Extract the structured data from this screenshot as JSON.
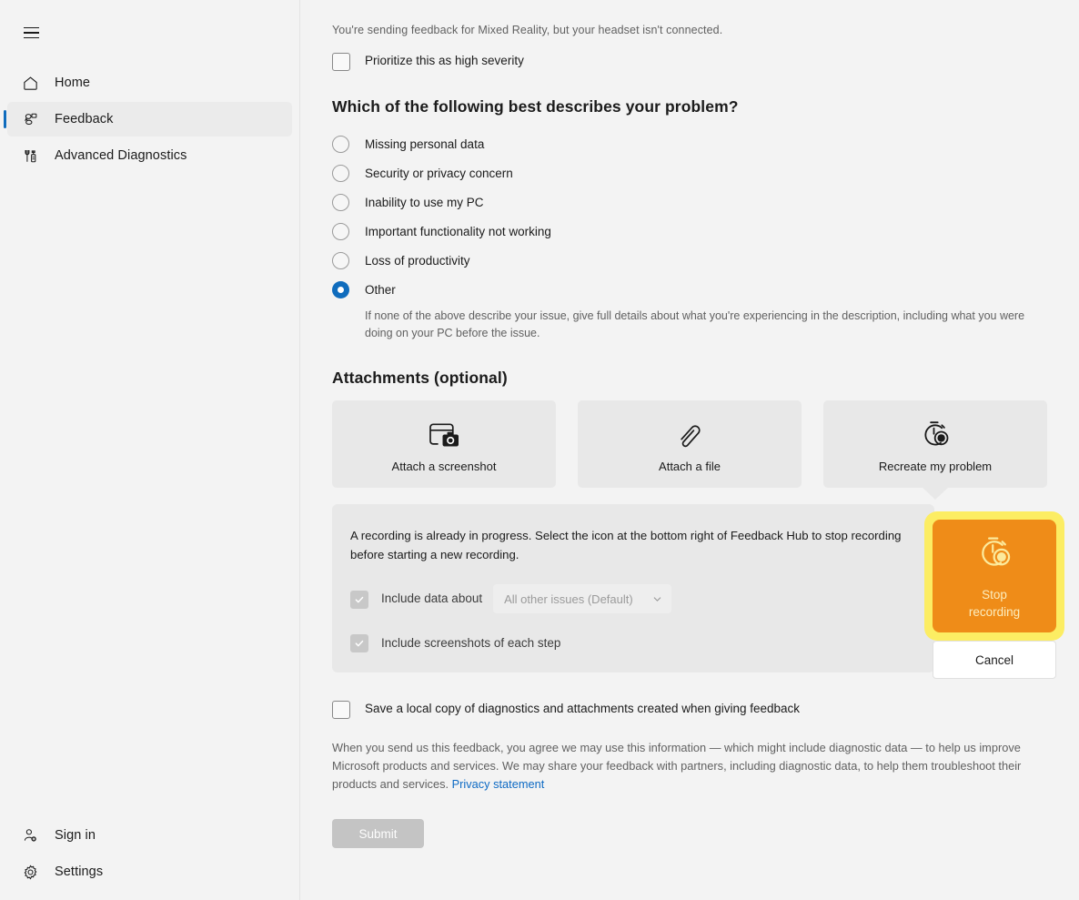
{
  "sidebar": {
    "menu_icon": "hamburger-icon",
    "items": [
      {
        "label": "Home",
        "icon": "home-icon",
        "active": false
      },
      {
        "label": "Feedback",
        "icon": "feedback-icon",
        "active": true
      },
      {
        "label": "Advanced Diagnostics",
        "icon": "diagnostics-icon",
        "active": false
      }
    ],
    "bottom_items": [
      {
        "label": "Sign in",
        "icon": "person-add-icon"
      },
      {
        "label": "Settings",
        "icon": "gear-icon"
      }
    ]
  },
  "main": {
    "headset_note": "You're sending feedback for Mixed Reality, but your headset isn't connected.",
    "priority_checkbox_label": "Prioritize this as high severity",
    "problem_heading": "Which of the following best describes your problem?",
    "problem_options": [
      {
        "label": "Missing personal data",
        "selected": false
      },
      {
        "label": "Security or privacy concern",
        "selected": false
      },
      {
        "label": "Inability to use my PC",
        "selected": false
      },
      {
        "label": "Important functionality not working",
        "selected": false
      },
      {
        "label": "Loss of productivity",
        "selected": false
      },
      {
        "label": "Other",
        "selected": true
      }
    ],
    "other_help_text": "If none of the above describe your issue, give full details about what you're experiencing in the description, including what you were doing on your PC before the issue.",
    "attachments_heading": "Attachments (optional)",
    "attachments": [
      {
        "label": "Attach a screenshot",
        "icon": "screenshot-icon"
      },
      {
        "label": "Attach a file",
        "icon": "paperclip-icon"
      },
      {
        "label": "Recreate my problem",
        "icon": "stopwatch-record-icon"
      }
    ],
    "recording_panel": {
      "message": "A recording is already in progress. Select the icon at the bottom right of Feedback Hub to stop recording before starting a new recording.",
      "include_data_label": "Include data about",
      "include_data_checked": true,
      "dropdown_value": "All other issues (Default)",
      "dropdown_icon": "chevron-down-icon",
      "include_screenshots_label": "Include screenshots of each step",
      "include_screenshots_checked": true
    },
    "stop_flyout": {
      "icon": "stopwatch-record-icon",
      "stop_label_line1": "Stop",
      "stop_label_line2": "recording",
      "cancel_label": "Cancel",
      "highlight_color": "#fced63",
      "button_color": "#ef8c18"
    },
    "save_local_copy_label": "Save a local copy of diagnostics and attachments created when giving feedback",
    "legal_text": "When you send us this feedback, you agree we may use this information — which might include diagnostic data — to help us improve Microsoft products and services. We may share your feedback with partners, including diagnostic data, to help them troubleshoot their products and services. ",
    "privacy_link": "Privacy statement",
    "submit_label": "Submit"
  }
}
